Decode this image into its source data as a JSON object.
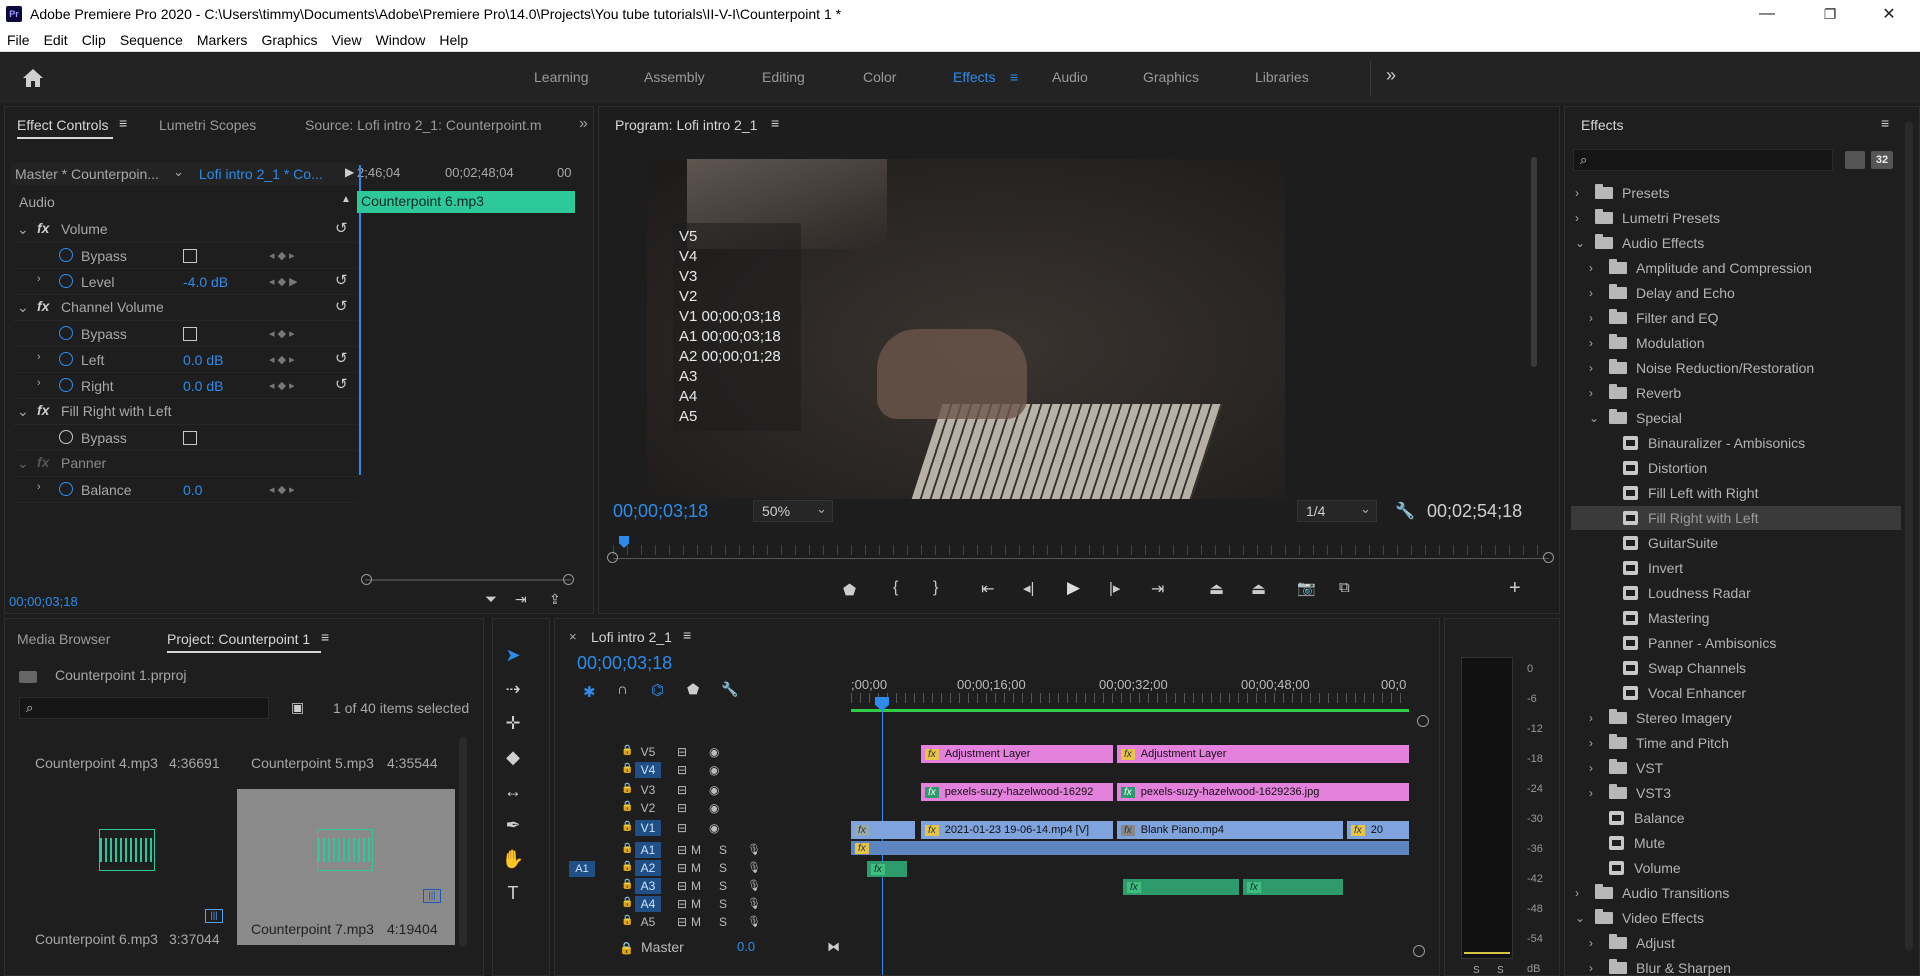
{
  "window": {
    "app_icon": "Pr",
    "title": "Adobe Premiere Pro 2020 - C:\\Users\\timmy\\Documents\\Adobe\\Premiere Pro\\14.0\\Projects\\You tube tutorials\\II-V-I\\Counterpoint 1 *",
    "minimize": "—",
    "maximize": "❐",
    "close": "✕"
  },
  "menu": [
    "File",
    "Edit",
    "Clip",
    "Sequence",
    "Markers",
    "Graphics",
    "View",
    "Window",
    "Help"
  ],
  "workspaces": {
    "tabs": [
      "Learning",
      "Assembly",
      "Editing",
      "Color",
      "Effects",
      "Audio",
      "Graphics",
      "Libraries"
    ],
    "active": "Effects",
    "more": "»"
  },
  "effect_controls": {
    "tabs": [
      "Effect Controls",
      "Lumetri Scopes",
      "Source: Lofi intro 2_1: Counterpoint.m"
    ],
    "master_label": "Master * Counterpoin...",
    "sequence_label": "Lofi intro 2_1 * Co...",
    "ruler": [
      "2;46;04",
      "00;02;48;04",
      "00"
    ],
    "clip_name": "Counterpoint 6.mp3",
    "section": "Audio",
    "rows": [
      {
        "type": "fx",
        "label": "Volume"
      },
      {
        "type": "param",
        "label": "Bypass",
        "control": "checkbox"
      },
      {
        "type": "param",
        "label": "Level",
        "value": "-4.0 dB"
      },
      {
        "type": "fx",
        "label": "Channel Volume"
      },
      {
        "type": "param",
        "label": "Bypass",
        "control": "checkbox"
      },
      {
        "type": "param",
        "label": "Left",
        "value": "0.0 dB"
      },
      {
        "type": "param",
        "label": "Right",
        "value": "0.0 dB"
      },
      {
        "type": "fx",
        "label": "Fill Right with Left"
      },
      {
        "type": "param",
        "label": "Bypass",
        "control": "checkbox"
      },
      {
        "type": "fx-disabled",
        "label": "Panner"
      },
      {
        "type": "param",
        "label": "Balance",
        "value": "0.0"
      }
    ],
    "timecode": "00;00;03;18"
  },
  "program": {
    "title": "Program: Lofi intro 2_1",
    "overlay_lines": [
      "V5",
      "V4",
      "V3",
      "V2",
      "V1 00;00;03;18",
      "A1 00;00;03;18",
      "A2 00;00;01;28",
      "A3",
      "A4",
      "A5"
    ],
    "timecode": "00;00;03;18",
    "zoom": "50%",
    "resolution": "1/4",
    "duration": "00;02;54;18"
  },
  "project": {
    "tabs": [
      "Media Browser",
      "Project: Counterpoint 1"
    ],
    "file": "Counterpoint 1.prproj",
    "items_selected": "1 of 40 items selected",
    "items": [
      {
        "name": "Counterpoint 4.mp3",
        "duration": "4:36691"
      },
      {
        "name": "Counterpoint 5.mp3",
        "duration": "4:35544"
      },
      {
        "name": "Counterpoint 6.mp3",
        "duration": "3:37044"
      },
      {
        "name": "Counterpoint 7.mp3",
        "duration": "4:19404"
      }
    ]
  },
  "timeline": {
    "tab": "Lofi intro 2_1",
    "timecode": "00;00;03;18",
    "ruler": [
      ";00;00",
      "00;00;16;00",
      "00;00;32;00",
      "00;00;48;00",
      "00;0"
    ],
    "video_tracks": [
      "V5",
      "V4",
      "V3",
      "V2",
      "V1"
    ],
    "audio_tracks": [
      "A1",
      "A2",
      "A3",
      "A4",
      "A5"
    ],
    "source_patch": "A1",
    "master_label": "Master",
    "master_value": "0.0",
    "mute_label": "M",
    "solo_label": "S",
    "clips": {
      "adjustment1": "Adjustment Layer",
      "adjustment2": "Adjustment Layer",
      "pexels1": "pexels-suzy-hazelwood-16292",
      "pexels2": "pexels-suzy-hazelwood-1629236.jpg",
      "v1a": "2021-01-23 19-06-14.mp4 [V]",
      "v1b": "Blank Piano.mp4",
      "v1c": "20",
      "fx": "fx"
    }
  },
  "audio_meter": {
    "scale": [
      "0",
      "-6",
      "-12",
      "-18",
      "-24",
      "-30",
      "-36",
      "-42",
      "-48",
      "-54",
      "dB"
    ],
    "footer": [
      "S",
      "S"
    ]
  },
  "effects_panel": {
    "title": "Effects",
    "badge": "32",
    "items": [
      {
        "label": "Presets",
        "level": 0,
        "kind": "folder",
        "open": false
      },
      {
        "label": "Lumetri Presets",
        "level": 0,
        "kind": "folder",
        "open": false
      },
      {
        "label": "Audio Effects",
        "level": 0,
        "kind": "folder",
        "open": true
      },
      {
        "label": "Amplitude and Compression",
        "level": 1,
        "kind": "folder",
        "open": false
      },
      {
        "label": "Delay and Echo",
        "level": 1,
        "kind": "folder",
        "open": false
      },
      {
        "label": "Filter and EQ",
        "level": 1,
        "kind": "folder",
        "open": false
      },
      {
        "label": "Modulation",
        "level": 1,
        "kind": "folder",
        "open": false
      },
      {
        "label": "Noise Reduction/Restoration",
        "level": 1,
        "kind": "folder",
        "open": false
      },
      {
        "label": "Reverb",
        "level": 1,
        "kind": "folder",
        "open": false
      },
      {
        "label": "Special",
        "level": 1,
        "kind": "folder",
        "open": true
      },
      {
        "label": "Binauralizer - Ambisonics",
        "level": 2,
        "kind": "effect"
      },
      {
        "label": "Distortion",
        "level": 2,
        "kind": "effect"
      },
      {
        "label": "Fill Left with Right",
        "level": 2,
        "kind": "effect"
      },
      {
        "label": "Fill Right with Left",
        "level": 2,
        "kind": "effect",
        "selected": true
      },
      {
        "label": "GuitarSuite",
        "level": 2,
        "kind": "effect"
      },
      {
        "label": "Invert",
        "level": 2,
        "kind": "effect"
      },
      {
        "label": "Loudness Radar",
        "level": 2,
        "kind": "effect"
      },
      {
        "label": "Mastering",
        "level": 2,
        "kind": "effect"
      },
      {
        "label": "Panner - Ambisonics",
        "level": 2,
        "kind": "effect"
      },
      {
        "label": "Swap Channels",
        "level": 2,
        "kind": "effect"
      },
      {
        "label": "Vocal Enhancer",
        "level": 2,
        "kind": "effect"
      },
      {
        "label": "Stereo Imagery",
        "level": 1,
        "kind": "folder",
        "open": false
      },
      {
        "label": "Time and Pitch",
        "level": 1,
        "kind": "folder",
        "open": false
      },
      {
        "label": "VST",
        "level": 1,
        "kind": "folder",
        "open": false
      },
      {
        "label": "VST3",
        "level": 1,
        "kind": "folder",
        "open": false
      },
      {
        "label": "Balance",
        "level": 1,
        "kind": "effect"
      },
      {
        "label": "Mute",
        "level": 1,
        "kind": "effect"
      },
      {
        "label": "Volume",
        "level": 1,
        "kind": "effect"
      },
      {
        "label": "Audio Transitions",
        "level": 0,
        "kind": "folder",
        "open": false
      },
      {
        "label": "Video Effects",
        "level": 0,
        "kind": "folder",
        "open": true
      },
      {
        "label": "Adjust",
        "level": 1,
        "kind": "folder",
        "open": false
      },
      {
        "label": "Blur & Sharpen",
        "level": 1,
        "kind": "folder",
        "open": false
      }
    ]
  }
}
